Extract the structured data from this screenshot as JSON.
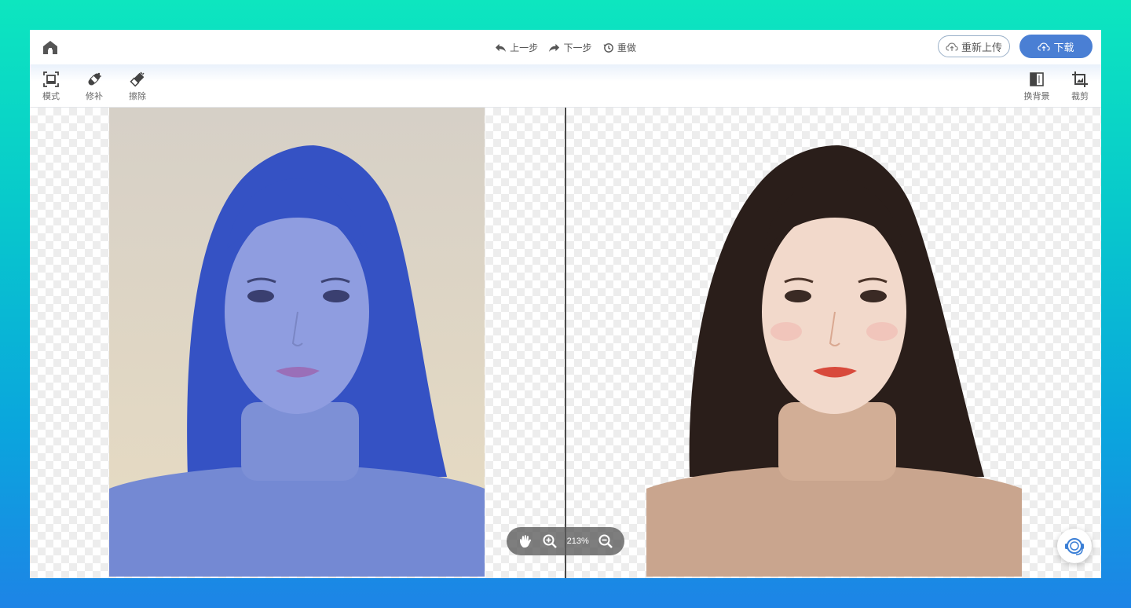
{
  "header": {
    "history": {
      "undo_label": "上一步",
      "redo_label": "下一步",
      "reset_label": "重做"
    },
    "reupload_label": "重新上传",
    "download_label": "下载"
  },
  "toolbar": {
    "left_tools": [
      {
        "label": "模式",
        "icon": "frame-icon"
      },
      {
        "label": "修补",
        "icon": "bandage-icon"
      },
      {
        "label": "擦除",
        "icon": "eraser-icon"
      }
    ],
    "right_tools": [
      {
        "label": "换背景",
        "icon": "background-swap-icon"
      },
      {
        "label": "裁剪",
        "icon": "crop-icon"
      }
    ]
  },
  "canvas": {
    "zoom_level": "213%",
    "left_panel": {
      "overlay_color": "#3f5bd0",
      "background_color": "#d8d0c2"
    },
    "right_panel": {
      "background": "transparent-checkerboard"
    }
  },
  "colors": {
    "accent": "#4a7fd4",
    "divider": "#4a4a4a",
    "page_gradient_top": "#0de6bf",
    "page_gradient_bottom": "#1d84e6"
  }
}
